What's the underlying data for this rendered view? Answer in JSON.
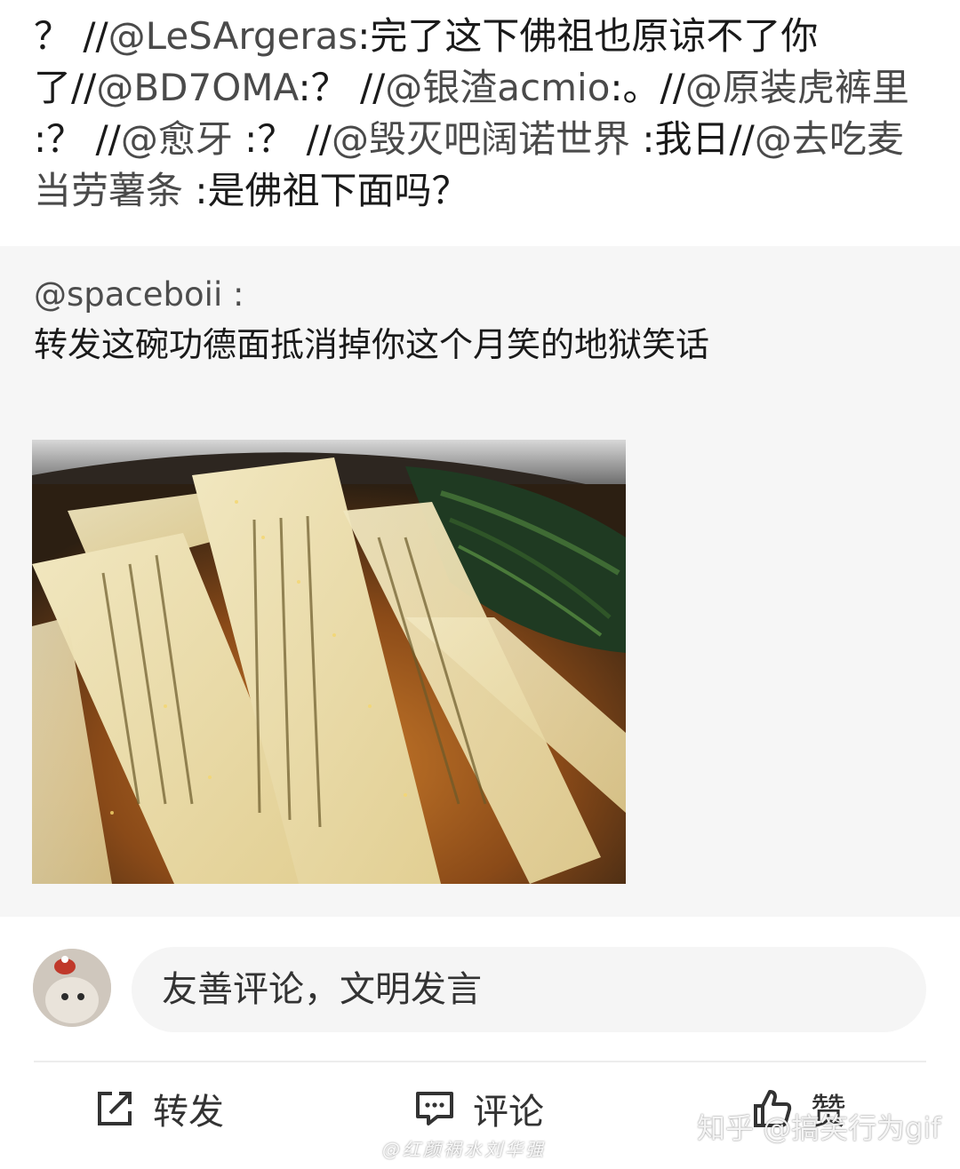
{
  "repost_chain": {
    "segments": [
      {
        "text": "？ //",
        "kind": "sep"
      },
      {
        "text": "@LeSArgeras",
        "kind": "mention"
      },
      {
        "text": ":完了这下佛祖也原谅不了你了//",
        "kind": "sep"
      },
      {
        "text": "@BD7OMA",
        "kind": "mention"
      },
      {
        "text": ":？ //",
        "kind": "sep"
      },
      {
        "text": "@银渣acmio",
        "kind": "mention"
      },
      {
        "text": ":。//",
        "kind": "sep"
      },
      {
        "text": "@原装虎裤里",
        "kind": "mention"
      },
      {
        "text": " :？ //",
        "kind": "sep"
      },
      {
        "text": "@愈牙",
        "kind": "mention"
      },
      {
        "text": " :？ //",
        "kind": "sep"
      },
      {
        "text": "@毁灭吧阔诺世界",
        "kind": "mention"
      },
      {
        "text": " :我日//",
        "kind": "sep"
      },
      {
        "text": "@去吃麦当劳薯条",
        "kind": "mention"
      },
      {
        "text": " :是佛祖下面吗？",
        "kind": "sep"
      }
    ]
  },
  "quoted_post": {
    "author": "@spaceboii :",
    "text": "转发这碗功德面抵消掉你这个月笑的地狱笑话"
  },
  "comment_box": {
    "placeholder": "友善评论，文明发言"
  },
  "actions": {
    "repost_label": "转发",
    "comment_label": "评论",
    "like_label": "赞"
  },
  "watermark": {
    "zhihu": "知乎 @搞笑行为gif",
    "bottom": "@红颜祸水刘华强"
  },
  "colors": {
    "quoted_bg": "#f6f6f6",
    "text_primary": "#1a1a1a",
    "text_secondary": "#4d4d4d",
    "input_bg": "#f5f5f5"
  },
  "icons": [
    "repost-icon",
    "comment-icon",
    "like-icon"
  ]
}
